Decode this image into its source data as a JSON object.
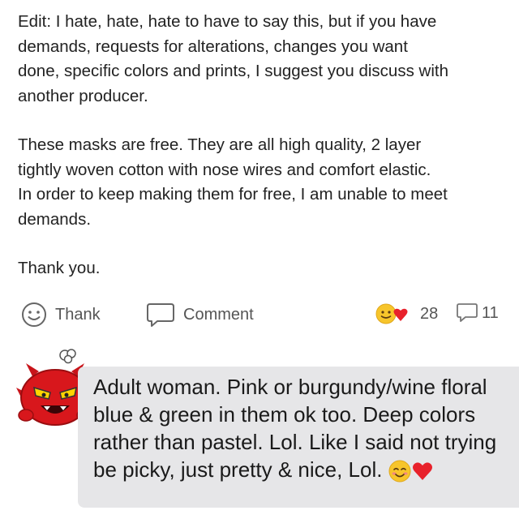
{
  "post": {
    "paragraphs": [
      [
        "Edit: I hate, hate, hate to have to say this, but if you have",
        "demands, requests for alterations, changes you want",
        "done, specific colors and prints, I suggest you discuss with",
        "another producer."
      ],
      [
        "These masks are free. They are all high quality, 2 layer",
        "tightly woven cotton with nose wires and comfort elastic.",
        "In order to keep making them for free, I am unable to meet",
        "demands."
      ],
      [
        "Thank you."
      ]
    ]
  },
  "actions": {
    "thank_label": "Thank",
    "comment_label": "Comment",
    "reactions_count": "28",
    "comments_count": "11"
  },
  "comment": {
    "lines": [
      "Adult woman. Pink or burgundy/wine floral",
      "blue & green in them ok too. Deep colors",
      "rather than pastel. Lol. Like I said not trying",
      "be picky, just pretty & nice, Lol."
    ]
  },
  "colors": {
    "bubble": "#e6e6e8",
    "avatar_red": "#d8171c",
    "heart": "#e8212b",
    "emoji_yellow": "#f7c52b"
  }
}
